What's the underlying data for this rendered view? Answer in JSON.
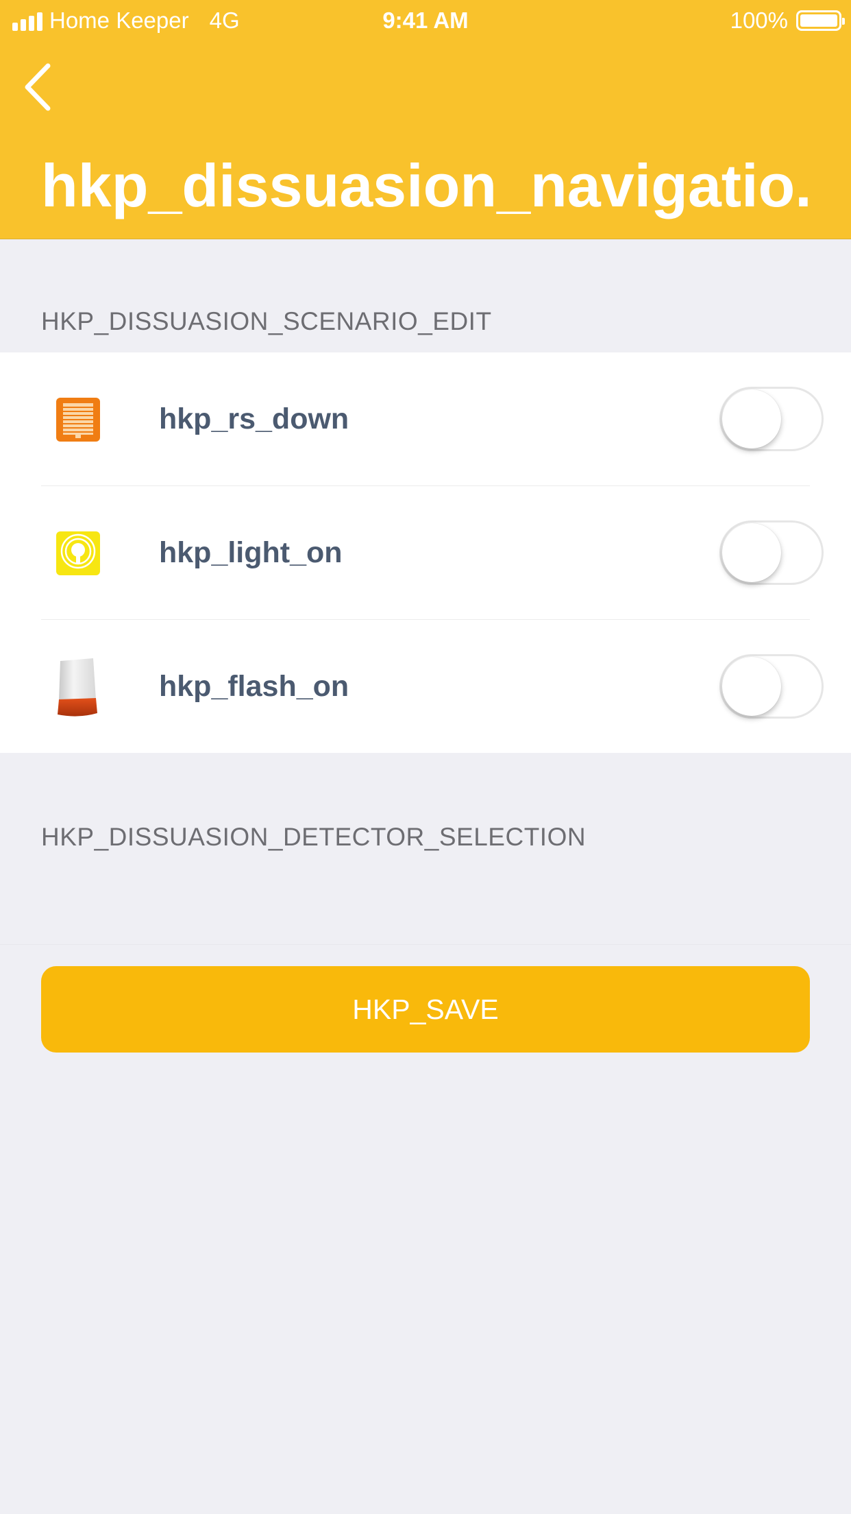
{
  "status_bar": {
    "carrier": "Home Keeper",
    "network": "4G",
    "time": "9:41 AM",
    "battery": "100%"
  },
  "nav": {
    "title": "hkp_dissuasion_navigatio..."
  },
  "sections": {
    "scenario_label": "HKP_DISSUASION_SCENARIO_EDIT",
    "detector_label": "HKP_DISSUASION_DETECTOR_SELECTION"
  },
  "scenario_items": [
    {
      "label": "hkp_rs_down",
      "icon": "roller-shutter-icon",
      "enabled": false
    },
    {
      "label": "hkp_light_on",
      "icon": "light-bulb-icon",
      "enabled": false
    },
    {
      "label": "hkp_flash_on",
      "icon": "siren-icon",
      "enabled": false
    }
  ],
  "save_button": {
    "label": "HKP_SAVE"
  },
  "colors": {
    "header": "#f9c22c",
    "button": "#f9b90b",
    "background": "#efeff4",
    "item_text": "#4b5a70"
  }
}
